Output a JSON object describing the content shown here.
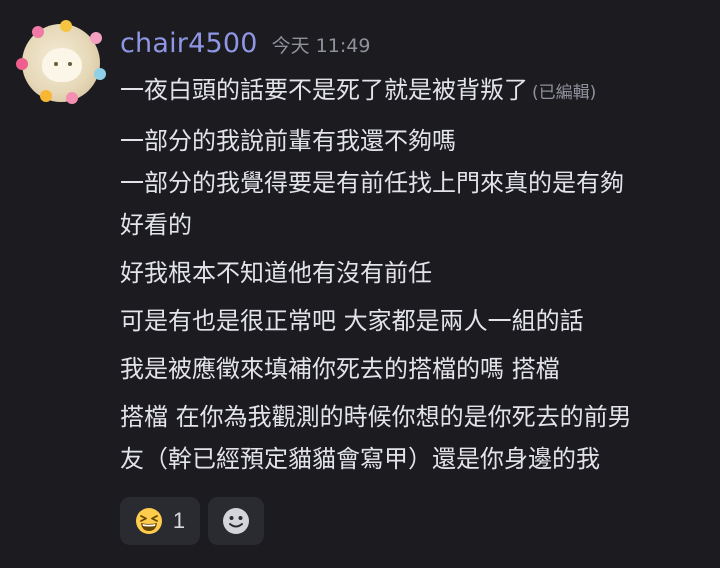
{
  "message": {
    "username": "chair4500",
    "timestamp": "今天 11:49",
    "edited_label": "(已編輯)",
    "lines": [
      "一夜白頭的話要不是死了就是被背叛了",
      "一部分的我說前輩有我還不夠嗎",
      "一部分的我覺得要是有前任找上門來真的是有夠",
      "好看的",
      "好我根本不知道他有沒有前任",
      "可是有也是很正常吧 大家都是兩人一組的話",
      "我是被應徵來填補你死去的搭檔的嗎 搭檔",
      "搭檔 在你為我觀測的時候你想的是你死去的前男",
      "友（幹已經預定貓貓會寫甲）還是你身邊的我"
    ]
  },
  "reactions": [
    {
      "icon": "grinning-squinting-face-icon",
      "count": "1"
    },
    {
      "icon": "add-reaction-icon",
      "count": ""
    }
  ],
  "colors": {
    "background": "#1b1b20",
    "username": "#8f96e3",
    "text": "#e3e4ea",
    "muted": "#8f929b",
    "reaction_bg": "#2a2b31"
  }
}
